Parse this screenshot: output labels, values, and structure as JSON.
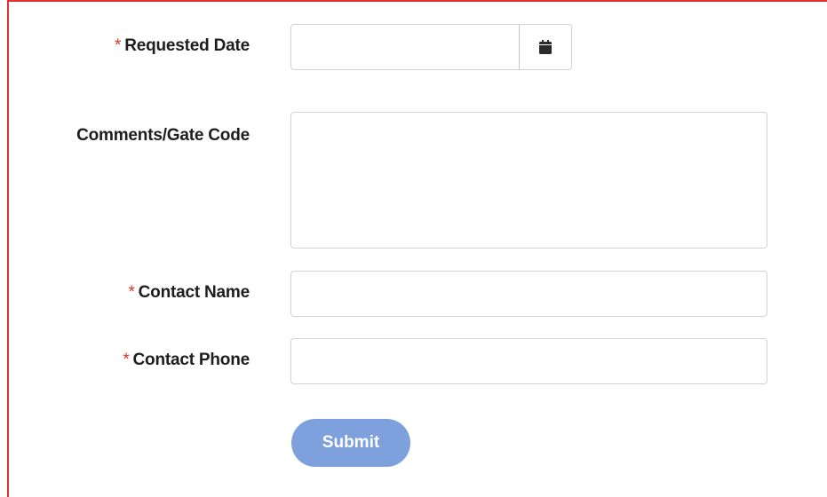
{
  "form": {
    "requested_date": {
      "required_mark": "*",
      "label": "Requested Date",
      "value": "",
      "placeholder": ""
    },
    "calendar_icon": "calendar-icon",
    "comments": {
      "label": "Comments/Gate Code",
      "value": "",
      "placeholder": ""
    },
    "contact_name": {
      "required_mark": "*",
      "label": "Contact Name",
      "value": "",
      "placeholder": ""
    },
    "contact_phone": {
      "required_mark": "*",
      "label": "Contact Phone",
      "value": "",
      "placeholder": ""
    },
    "submit_label": "Submit"
  },
  "colors": {
    "frame_border": "#e0312e",
    "required": "#d9342b",
    "submit_bg": "#7ea1de",
    "input_border": "#d2d2d2"
  }
}
